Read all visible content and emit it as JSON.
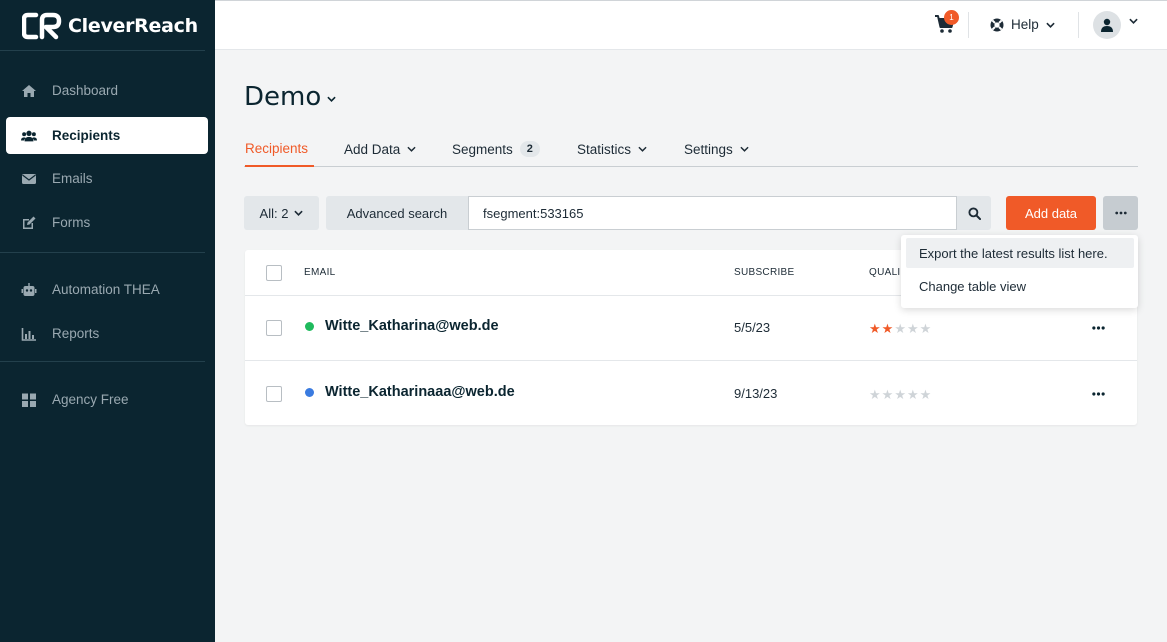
{
  "brand": {
    "name": "CleverReach"
  },
  "sidebar": {
    "items": [
      {
        "label": "Dashboard",
        "icon": "home-icon"
      },
      {
        "label": "Recipients",
        "icon": "users-icon"
      },
      {
        "label": "Emails",
        "icon": "envelope-icon"
      },
      {
        "label": "Forms",
        "icon": "edit-icon"
      },
      {
        "label": "Automation THEA",
        "icon": "robot-icon"
      },
      {
        "label": "Reports",
        "icon": "bar-chart-icon"
      },
      {
        "label": "Agency Free",
        "icon": "grid-icon"
      }
    ],
    "active_index": 1
  },
  "topbar": {
    "cart_count": "1",
    "help_label": "Help"
  },
  "page": {
    "title": "Demo"
  },
  "tabs": [
    {
      "label": "Recipients"
    },
    {
      "label": "Add Data"
    },
    {
      "label": "Segments",
      "badge": "2"
    },
    {
      "label": "Statistics"
    },
    {
      "label": "Settings"
    }
  ],
  "toolbar": {
    "filter_label": "All: 2",
    "advanced_search_label": "Advanced search",
    "search_value": "fsegment:533165",
    "add_data_label": "Add data"
  },
  "table": {
    "columns": [
      "EMAIL",
      "SUBSCRIBE",
      "QUALI"
    ],
    "rows": [
      {
        "email": "Witte_Katharina@web.de",
        "date": "5/5/23",
        "status_color": "#1fba5d",
        "rating": 2
      },
      {
        "email": "Witte_Katharinaaa@web.de",
        "date": "9/13/23",
        "status_color": "#3a7be0",
        "rating": 0
      }
    ]
  },
  "dropdown": {
    "items": [
      "Export the latest results list here.",
      "Change table view"
    ]
  },
  "colors": {
    "accent": "#f05a28",
    "sidebar_bg": "#0b2530"
  }
}
